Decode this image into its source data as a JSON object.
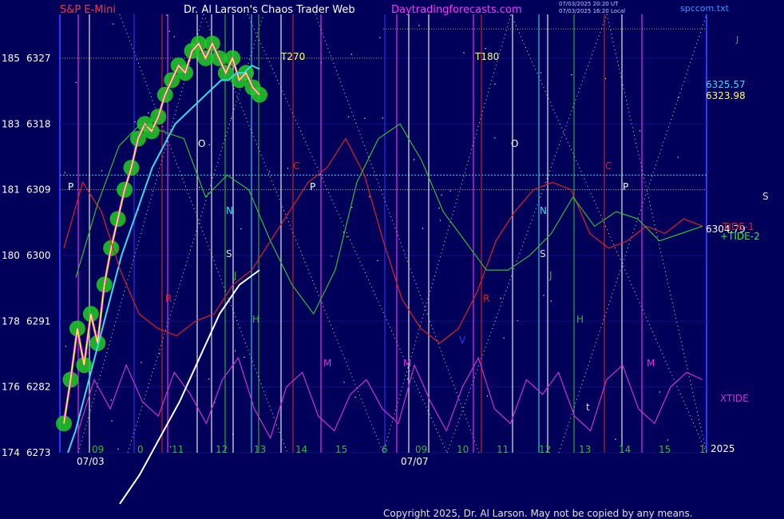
{
  "header": {
    "symbol": "S&P E-Mini",
    "title": "Dr. Al Larson's Chaos Trader Web",
    "site": "Daytradingforecasts.com",
    "stamp_ut": "07/03/2025 20:20 UT",
    "stamp_local": "07/03/2025 16:20 Local",
    "file": "spccom.txt"
  },
  "footer": {
    "copyright": "Copyright 2025, Dr. Al Larson. May not be copied by any means."
  },
  "colors": {
    "background": "#00005a",
    "price": "#ffff33",
    "glow": "#22cc22",
    "ma": "#33ddee",
    "tide1": "#dd2222",
    "tide2": "#33bb33",
    "xtide": "#cc33cc",
    "accent": "#dd33dd"
  },
  "chart_data": {
    "type": "line",
    "title": "S&P E-Mini",
    "y_axis": {
      "range": [
        6273,
        6333
      ],
      "ticks": [
        {
          "value": 6273,
          "left": "174",
          "right": "6273"
        },
        {
          "value": 6282,
          "left": "176",
          "right": "6282"
        },
        {
          "value": 6291,
          "left": "178",
          "right": "6291"
        },
        {
          "value": 6300,
          "left": "180",
          "right": "6300"
        },
        {
          "value": 6309,
          "left": "181",
          "right": "6309"
        },
        {
          "value": 6318,
          "left": "183",
          "right": "6318"
        },
        {
          "value": 6327,
          "left": "185",
          "right": "6327"
        }
      ]
    },
    "x_axis": {
      "hour_labels": [
        "09",
        "0",
        "11",
        "12",
        "13",
        "14",
        "15",
        "6",
        "09",
        "10",
        "11",
        "12",
        "13",
        "14",
        "15",
        "1"
      ],
      "date_labels": [
        "07/03",
        "07/07"
      ],
      "year_label": "2025"
    },
    "price_readouts": [
      "6325.57",
      "6323.98",
      "6304.79"
    ],
    "series_labels": [
      "TIDE-1",
      "+TIDE-2",
      "XTIDE",
      "J"
    ],
    "annotations": [
      "T270",
      "T180",
      "O",
      "P",
      "C",
      "N",
      "S",
      "J",
      "H",
      "R",
      "M",
      "V",
      "t"
    ],
    "series": [
      {
        "name": "price",
        "values": [
          6277,
          6283,
          6290,
          6285,
          6292,
          6288,
          6296,
          6301,
          6305,
          6309,
          6312,
          6316,
          6318,
          6317,
          6319,
          6322,
          6324,
          6326,
          6325,
          6328,
          6329,
          6327,
          6329,
          6327,
          6325,
          6327,
          6324,
          6325,
          6323,
          6322
        ]
      },
      {
        "name": "average",
        "values": [
          6273,
          6276,
          6280,
          6284,
          6288,
          6292,
          6296,
          6300,
          6303,
          6306,
          6309,
          6312,
          6314,
          6316,
          6318,
          6319,
          6320,
          6321,
          6322,
          6323,
          6324,
          6324,
          6325,
          6325,
          6326,
          6325.5
        ]
      },
      {
        "name": "TIDE-1",
        "values": [
          6301,
          6310,
          6306,
          6298,
          6292,
          6290,
          6289,
          6291,
          6292,
          6296,
          6298,
          6302,
          6306,
          6310,
          6312,
          6316,
          6311,
          6302,
          6294,
          6290,
          6288,
          6290,
          6295,
          6302,
          6306,
          6309,
          6310,
          6309,
          6303,
          6301,
          6302,
          6304,
          6303,
          6305,
          6304
        ]
      },
      {
        "name": "TIDE-2",
        "values": [
          6297,
          6307,
          6315,
          6318,
          6317,
          6316,
          6308,
          6311,
          6309,
          6302,
          6296,
          6292,
          6298,
          6310,
          6316,
          6318,
          6313,
          6306,
          6302,
          6298,
          6298,
          6300,
          6303,
          6308,
          6304,
          6306,
          6305,
          6302,
          6303,
          6304
        ]
      },
      {
        "name": "XTIDE",
        "values": [
          6276,
          6283,
          6279,
          6285,
          6280,
          6278,
          6284,
          6281,
          6277,
          6283,
          6286,
          6279,
          6275,
          6282,
          6284,
          6278,
          6276,
          6281,
          6283,
          6279,
          6277,
          6285,
          6280,
          6276,
          6282,
          6286,
          6279,
          6277,
          6283,
          6281,
          6284,
          6278,
          6276,
          6283,
          6285,
          6279,
          6277,
          6282,
          6284,
          6283
        ]
      },
      {
        "name": "J-line",
        "values": [
          6266,
          6270,
          6275,
          6280,
          6286,
          6292,
          6296,
          6298
        ]
      }
    ]
  }
}
